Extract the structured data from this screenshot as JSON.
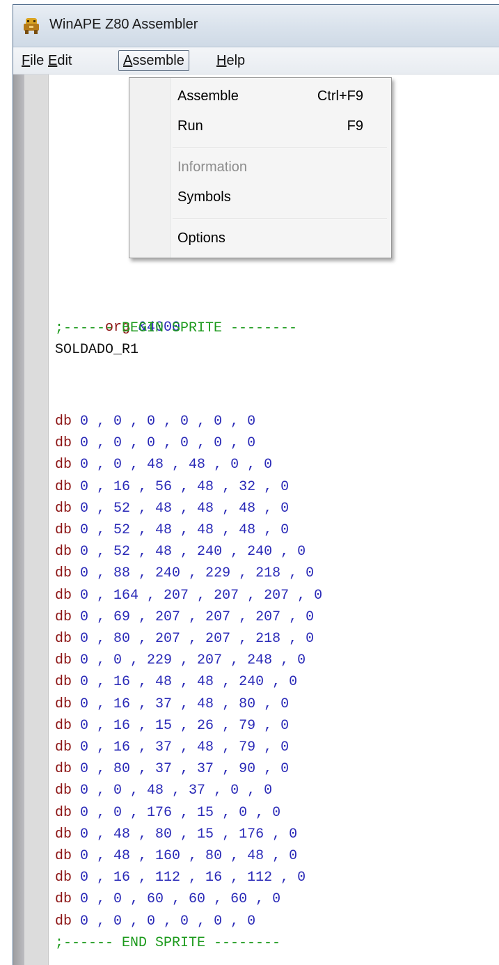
{
  "window": {
    "title": "WinAPE Z80 Assembler",
    "icon": "winape-app-icon"
  },
  "menubar": {
    "items": [
      {
        "label": "File",
        "mnemonic": "F"
      },
      {
        "label": "Edit",
        "mnemonic": "E"
      },
      {
        "label": "Assemble",
        "mnemonic": "A",
        "open": true
      },
      {
        "label": "Help",
        "mnemonic": "H"
      }
    ]
  },
  "assemble_menu": {
    "items": [
      {
        "label": "Assemble",
        "shortcut": "Ctrl+F9",
        "enabled": true
      },
      {
        "label": "Run",
        "shortcut": "F9",
        "enabled": true
      },
      {
        "label": "Information",
        "shortcut": "",
        "enabled": false
      },
      {
        "label": "Symbols",
        "shortcut": "",
        "enabled": true
      },
      {
        "label": "Options",
        "shortcut": "",
        "enabled": true
      }
    ]
  },
  "editor": {
    "org_keyword": "org",
    "org_value": "&4000",
    "begin_comment": ";------ BEGIN SPRITE --------",
    "label": "SOLDADO_R1",
    "db_keyword": "db",
    "db_rows": [
      "0 , 0 , 0 , 0 , 0 , 0",
      "0 , 0 , 0 , 0 , 0 , 0",
      "0 , 0 , 48 , 48 , 0 , 0",
      "0 , 16 , 56 , 48 , 32 , 0",
      "0 , 52 , 48 , 48 , 48 , 0",
      "0 , 52 , 48 , 48 , 48 , 0",
      "0 , 52 , 48 , 240 , 240 , 0",
      "0 , 88 , 240 , 229 , 218 , 0",
      "0 , 164 , 207 , 207 , 207 , 0",
      "0 , 69 , 207 , 207 , 207 , 0",
      "0 , 80 , 207 , 207 , 218 , 0",
      "0 , 0 , 229 , 207 , 248 , 0",
      "0 , 16 , 48 , 48 , 240 , 0",
      "0 , 16 , 37 , 48 , 80 , 0",
      "0 , 16 , 15 , 26 , 79 , 0",
      "0 , 16 , 37 , 48 , 79 , 0",
      "0 , 80 , 37 , 37 , 90 , 0",
      "0 , 0 , 48 , 37 , 0 , 0",
      "0 , 0 , 176 , 15 , 0 , 0",
      "0 , 48 , 80 , 15 , 176 , 0",
      "0 , 48 , 160 , 80 , 48 , 0",
      "0 , 16 , 112 , 16 , 112 , 0",
      "0 , 0 , 60 , 60 , 60 , 0",
      "0 , 0 , 0 , 0 , 0 , 0"
    ],
    "end_comment": ";------ END SPRITE --------"
  },
  "colors": {
    "keyword": "#8b1212",
    "number": "#2b2bb8",
    "comment": "#1c9a1c",
    "label": "#111111"
  }
}
